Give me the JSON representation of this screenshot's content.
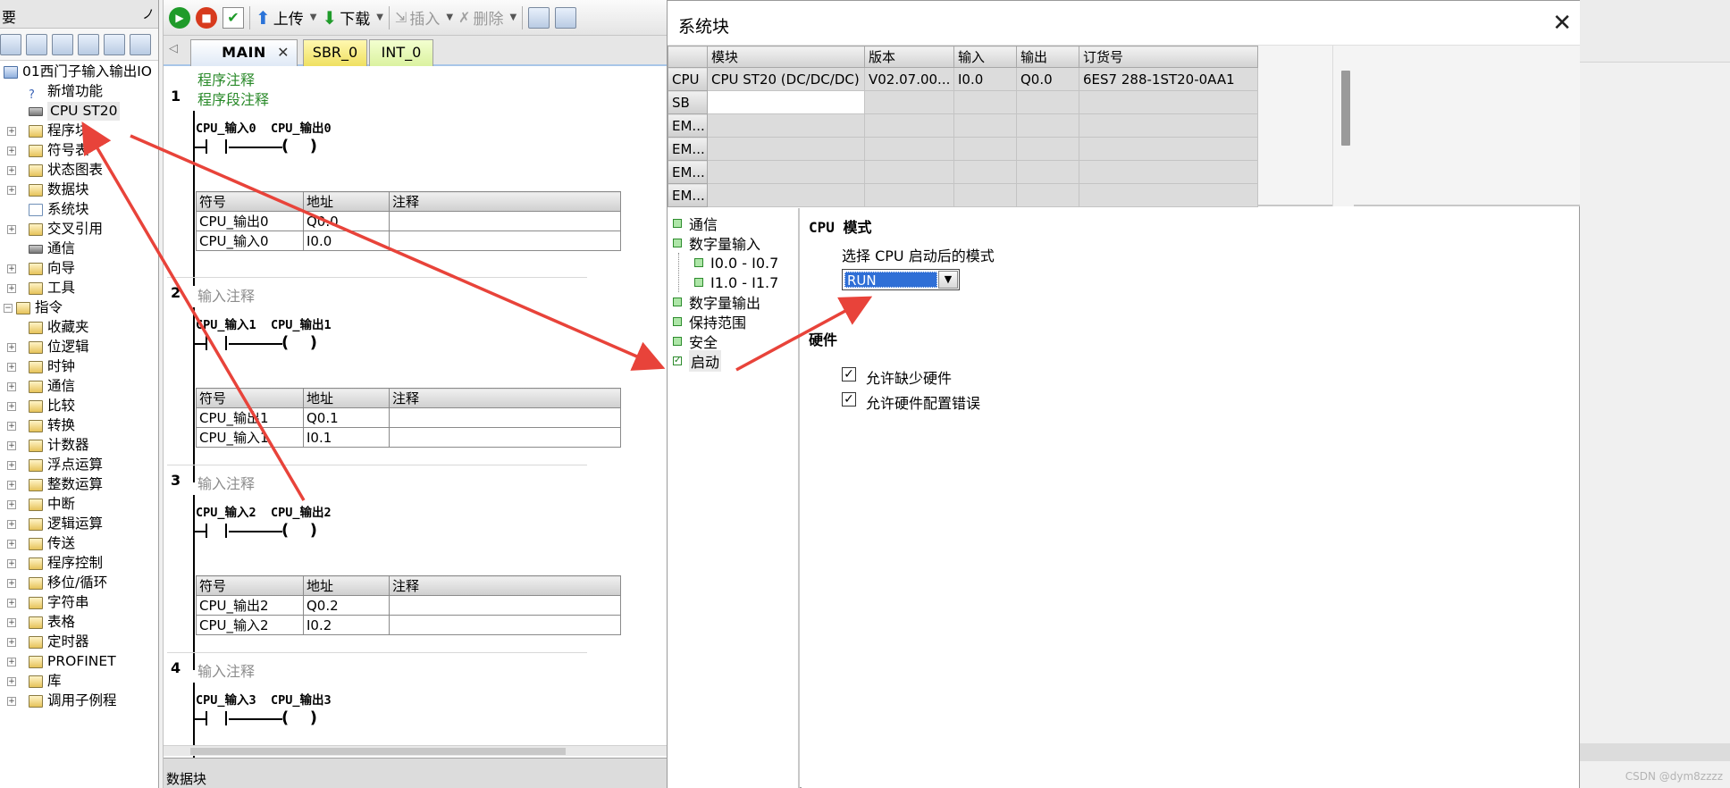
{
  "tree_pane": {
    "header_title": "要",
    "pin_glyph": "ノ",
    "items": [
      {
        "label": "01西门子输入输出IO",
        "icon": "project-icon",
        "indent": 0,
        "expander": "none",
        "iconStyle": "blue"
      },
      {
        "label": "新增功能",
        "icon": "help-icon",
        "indent": 1,
        "expander": "none",
        "iconStyle": "help"
      },
      {
        "label": "CPU ST20",
        "icon": "cpu-icon",
        "indent": 1,
        "expander": "none",
        "iconStyle": "cpu",
        "selected": true
      },
      {
        "label": "程序块",
        "icon": "folder-icon",
        "indent": 1,
        "expander": "plus"
      },
      {
        "label": "符号表",
        "icon": "folder-icon",
        "indent": 1,
        "expander": "plus"
      },
      {
        "label": "状态图表",
        "icon": "folder-icon",
        "indent": 1,
        "expander": "plus"
      },
      {
        "label": "数据块",
        "icon": "folder-icon",
        "indent": 1,
        "expander": "plus"
      },
      {
        "label": "系统块",
        "icon": "document-icon",
        "indent": 1,
        "expander": "none",
        "iconStyle": "doc"
      },
      {
        "label": "交叉引用",
        "icon": "folder-icon",
        "indent": 1,
        "expander": "plus"
      },
      {
        "label": "通信",
        "icon": "network-icon",
        "indent": 1,
        "expander": "none",
        "iconStyle": "cpu"
      },
      {
        "label": "向导",
        "icon": "wizard-icon",
        "indent": 1,
        "expander": "plus"
      },
      {
        "label": "工具",
        "icon": "folder-icon",
        "indent": 1,
        "expander": "plus"
      },
      {
        "label": "指令",
        "icon": "folder-icon",
        "indent": 0,
        "expander": "minus"
      },
      {
        "label": "收藏夹",
        "icon": "folder-icon",
        "indent": 1,
        "expander": "none"
      },
      {
        "label": "位逻辑",
        "icon": "folder-icon",
        "indent": 1,
        "expander": "plus"
      },
      {
        "label": "时钟",
        "icon": "folder-icon",
        "indent": 1,
        "expander": "plus"
      },
      {
        "label": "通信",
        "icon": "folder-icon",
        "indent": 1,
        "expander": "plus"
      },
      {
        "label": "比较",
        "icon": "folder-icon",
        "indent": 1,
        "expander": "plus"
      },
      {
        "label": "转换",
        "icon": "folder-icon",
        "indent": 1,
        "expander": "plus"
      },
      {
        "label": "计数器",
        "icon": "folder-icon",
        "indent": 1,
        "expander": "plus"
      },
      {
        "label": "浮点运算",
        "icon": "folder-icon",
        "indent": 1,
        "expander": "plus"
      },
      {
        "label": "整数运算",
        "icon": "folder-icon",
        "indent": 1,
        "expander": "plus"
      },
      {
        "label": "中断",
        "icon": "folder-icon",
        "indent": 1,
        "expander": "plus"
      },
      {
        "label": "逻辑运算",
        "icon": "folder-icon",
        "indent": 1,
        "expander": "plus"
      },
      {
        "label": "传送",
        "icon": "folder-icon",
        "indent": 1,
        "expander": "plus"
      },
      {
        "label": "程序控制",
        "icon": "folder-icon",
        "indent": 1,
        "expander": "plus"
      },
      {
        "label": "移位/循环",
        "icon": "folder-icon",
        "indent": 1,
        "expander": "plus"
      },
      {
        "label": "字符串",
        "icon": "folder-icon",
        "indent": 1,
        "expander": "plus"
      },
      {
        "label": "表格",
        "icon": "folder-icon",
        "indent": 1,
        "expander": "plus"
      },
      {
        "label": "定时器",
        "icon": "folder-icon",
        "indent": 1,
        "expander": "plus"
      },
      {
        "label": "PROFINET",
        "icon": "folder-icon",
        "indent": 1,
        "expander": "plus"
      },
      {
        "label": "库",
        "icon": "folder-icon",
        "indent": 1,
        "expander": "plus"
      },
      {
        "label": "调用子例程",
        "icon": "folder-icon",
        "indent": 1,
        "expander": "plus"
      }
    ]
  },
  "main_toolbar": {
    "upload_label": "上传",
    "download_label": "下载",
    "insert_label": "插入",
    "delete_label": "删除"
  },
  "editor_tabs": {
    "main": "MAIN",
    "sbr": "SBR_0",
    "int": "INT_0",
    "close_glyph": "✕"
  },
  "program": {
    "program_comment": "程序注释",
    "networks": [
      {
        "number": "1",
        "title": "程序段注释",
        "title_style": "green",
        "contact_label": "CPU_输入0",
        "coil_label": "CPU_输出0",
        "table": {
          "headers": [
            "符号",
            "地址",
            "注释"
          ],
          "rows": [
            [
              "CPU_输出0",
              "Q0.0",
              ""
            ],
            [
              "CPU_输入0",
              "I0.0",
              ""
            ]
          ]
        }
      },
      {
        "number": "2",
        "title": "输入注释",
        "title_style": "gray",
        "contact_label": "CPU_输入1",
        "coil_label": "CPU_输出1",
        "table": {
          "headers": [
            "符号",
            "地址",
            "注释"
          ],
          "rows": [
            [
              "CPU_输出1",
              "Q0.1",
              ""
            ],
            [
              "CPU_输入1",
              "I0.1",
              ""
            ]
          ]
        }
      },
      {
        "number": "3",
        "title": "输入注释",
        "title_style": "gray",
        "contact_label": "CPU_输入2",
        "coil_label": "CPU_输出2",
        "table": {
          "headers": [
            "符号",
            "地址",
            "注释"
          ],
          "rows": [
            [
              "CPU_输出2",
              "Q0.2",
              ""
            ],
            [
              "CPU_输入2",
              "I0.2",
              ""
            ]
          ]
        }
      },
      {
        "number": "4",
        "title": "输入注释",
        "title_style": "gray",
        "contact_label": "CPU_输入3",
        "coil_label": "CPU_输出3",
        "table": null
      }
    ]
  },
  "bottom_panel": {
    "label": "数据块"
  },
  "system_block_dialog": {
    "title": "系统块",
    "close_glyph": "✕",
    "module_table": {
      "headers": [
        "",
        "模块",
        "版本",
        "输入",
        "输出",
        "订货号"
      ],
      "rows": [
        [
          "CPU",
          "CPU ST20 (DC/DC/DC)",
          "V02.07.00...",
          "I0.0",
          "Q0.0",
          "6ES7 288-1ST20-0AA1"
        ],
        [
          "SB",
          "",
          "",
          "",
          "",
          ""
        ],
        [
          "EM...",
          "",
          "",
          "",
          "",
          ""
        ],
        [
          "EM...",
          "",
          "",
          "",
          "",
          ""
        ],
        [
          "EM...",
          "",
          "",
          "",
          "",
          ""
        ],
        [
          "EM...",
          "",
          "",
          "",
          "",
          ""
        ]
      ]
    },
    "config_tree": [
      {
        "label": "通信",
        "level": 0,
        "checked": false
      },
      {
        "label": "数字量输入",
        "level": 0,
        "checked": false
      },
      {
        "label": "I0.0 - I0.7",
        "level": 1,
        "checked": false
      },
      {
        "label": "I1.0 - I1.7",
        "level": 1,
        "checked": false
      },
      {
        "label": "数字量输出",
        "level": 0,
        "checked": false
      },
      {
        "label": "保持范围",
        "level": 0,
        "checked": false
      },
      {
        "label": "安全",
        "level": 0,
        "checked": false
      },
      {
        "label": "启动",
        "level": 0,
        "checked": true,
        "selected": true
      }
    ],
    "startup_panel": {
      "cpu_mode_title": "CPU 模式",
      "startup_mode_label": "选择 CPU 启动后的模式",
      "startup_mode_value": "RUN",
      "hardware_title": "硬件",
      "allow_missing_hw": {
        "label": "允许缺少硬件",
        "checked": true
      },
      "allow_hw_config_error": {
        "label": "允许硬件配置错误",
        "checked": true
      }
    }
  },
  "watermark": "CSDN @dym8zzzz",
  "colors": {
    "annotation_arrow": "#e8433a",
    "selection_blue": "#2f6fd6",
    "comment_green": "#2a8a2a"
  }
}
